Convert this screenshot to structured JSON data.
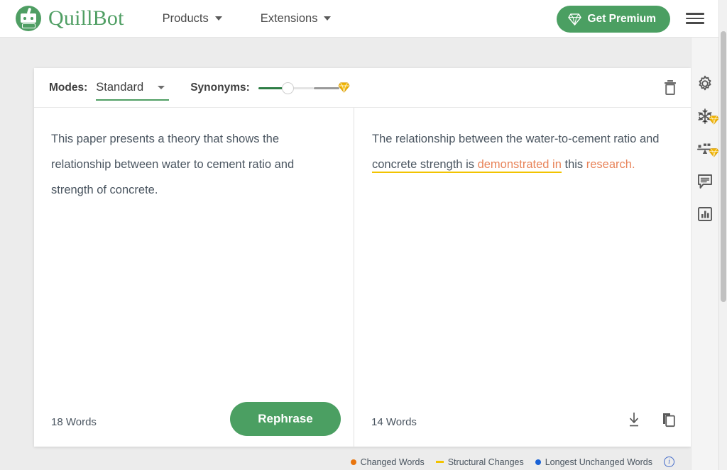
{
  "brand": {
    "name": "QuillBot",
    "logo_icon": "quillbot-robot-logo",
    "logo_color": "#4f9e63"
  },
  "topnav": {
    "links": [
      {
        "label": "Products",
        "icon": "chevron-down-icon"
      },
      {
        "label": "Extensions",
        "icon": "chevron-down-icon"
      }
    ],
    "premium_button": {
      "label": "Get Premium",
      "icon": "diamond-icon",
      "color": "#4b9f62"
    },
    "menu_icon": "hamburger-menu-icon"
  },
  "toolbar": {
    "modes_label": "Modes:",
    "mode_value": "Standard",
    "mode_caret_icon": "chevron-down-icon",
    "synonyms_label": "Synonyms:",
    "slider_gem_icon": "diamond-icon",
    "delete_icon": "trash-icon",
    "accent_color": "#4f9e63"
  },
  "editor": {
    "input": {
      "text": "This paper presents a theory that shows the relationship between water to cement ratio and strength of concrete.",
      "word_count": "18 Words",
      "rephrase_label": "Rephrase"
    },
    "output": {
      "segments": [
        {
          "text": "The relationship between the water-to-cement ratio and ",
          "style": "plain"
        },
        {
          "text": "concrete strength is ",
          "style": "structural"
        },
        {
          "text": "demonstrated in",
          "style": "changed-structural"
        },
        {
          "text": " this ",
          "style": "plain"
        },
        {
          "text": "research.",
          "style": "changed"
        }
      ],
      "full_text": "The relationship between the water-to-cement ratio and concrete strength is demonstrated in this research.",
      "word_count": "14 Words",
      "download_icon": "download-icon",
      "copy_icon": "copy-icon"
    }
  },
  "rail": {
    "items": [
      {
        "icon": "gear-icon",
        "premium": false
      },
      {
        "icon": "snowflake-freeze-icon",
        "premium": true
      },
      {
        "icon": "balance-scale-icon",
        "premium": true
      },
      {
        "icon": "comment-icon",
        "premium": false
      },
      {
        "icon": "bar-chart-icon",
        "premium": false
      }
    ]
  },
  "legend": {
    "items": [
      {
        "label": "Changed Words",
        "marker": "dot",
        "color": "#e8740c"
      },
      {
        "label": "Structural Changes",
        "marker": "dash",
        "color": "#f2c300"
      },
      {
        "label": "Longest Unchanged Words",
        "marker": "dot",
        "color": "#1a62d6"
      }
    ],
    "info_icon": "info-icon",
    "info_glyph": "i"
  }
}
